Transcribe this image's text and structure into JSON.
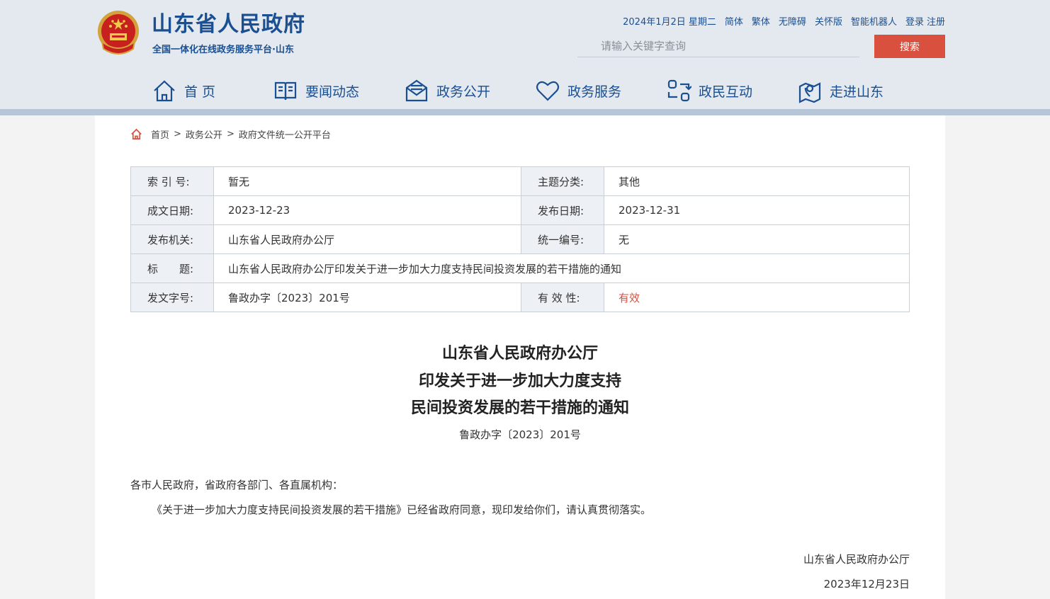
{
  "header": {
    "site_title": "山东省人民政府",
    "site_subtitle": "全国一体化在线政务服务平台·山东",
    "emblem_icon": "national-emblem-icon",
    "top_links": {
      "date": "2024年1月2日 星期二",
      "simplified": "简体",
      "traditional": "繁体",
      "accessibility": "无障碍",
      "care_mode": "关怀版",
      "robot": "智能机器人",
      "login": "登录",
      "register": "注册"
    },
    "search": {
      "placeholder": "请输入关键字查询",
      "button_label": "搜索"
    },
    "nav": [
      {
        "label": "首 页",
        "icon": "home-icon"
      },
      {
        "label": "要闻动态",
        "icon": "book-icon"
      },
      {
        "label": "政务公开",
        "icon": "envelope-icon"
      },
      {
        "label": "政务服务",
        "icon": "heart-icon"
      },
      {
        "label": "政民互动",
        "icon": "interaction-icon"
      },
      {
        "label": "走进山东",
        "icon": "map-pin-icon"
      }
    ]
  },
  "breadcrumb": {
    "icon": "home-icon",
    "items": [
      "首页",
      "政务公开",
      "政府文件统一公开平台"
    ],
    "separator": ">"
  },
  "meta": {
    "index_label": "索 引 号:",
    "index_value": "暂无",
    "category_label": "主题分类:",
    "category_value": "其他",
    "written_date_label": "成文日期:",
    "written_date_value": "2023-12-23",
    "publish_date_label": "发布日期:",
    "publish_date_value": "2023-12-31",
    "issuer_label": "发布机关:",
    "issuer_value": "山东省人民政府办公厅",
    "unified_no_label": "统一编号:",
    "unified_no_value": "无",
    "title_label": "标　　题:",
    "title_value": "山东省人民政府办公厅印发关于进一步加大力度支持民间投资发展的若干措施的通知",
    "doc_no_label": "发文字号:",
    "doc_no_value": "鲁政办字〔2023〕201号",
    "validity_label": "有 效 性:",
    "validity_value": "有效"
  },
  "document": {
    "title_lines": [
      "山东省人民政府办公厅",
      "印发关于进一步加大力度支持",
      "民间投资发展的若干措施的通知"
    ],
    "number": "鲁政办字〔2023〕201号",
    "salutation": "各市人民政府，省政府各部门、各直属机构：",
    "body": "《关于进一步加大力度支持民间投资发展的若干措施》已经省政府同意，现印发给你们，请认真贯彻落实。",
    "signature_org": "山东省人民政府办公厅",
    "signature_date": "2023年12月23日"
  },
  "colors": {
    "brand_blue": "#1a4f91",
    "accent_red": "#d9503f",
    "header_bg": "#e4e9f0",
    "label_bg": "#edf1f6"
  }
}
